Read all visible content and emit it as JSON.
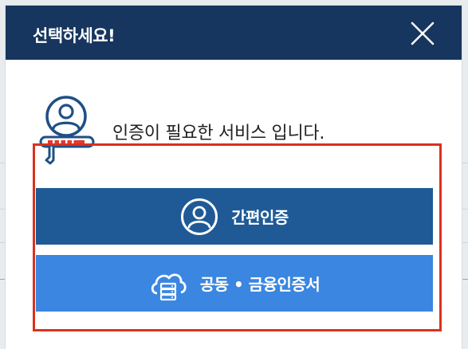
{
  "modal": {
    "title": "선택하세요!",
    "intro_text": "인증이 필요한 서비스 입니다.",
    "buttons": {
      "simple_auth": {
        "label": "간편인증",
        "icon": "user-circle-icon"
      },
      "certificate": {
        "label": "공동 • 금융인증서",
        "icon": "cloud-server-icon"
      }
    }
  },
  "colors": {
    "header_bg": "#16365f",
    "simple_button_bg": "#1f5a96",
    "certificate_button_bg": "#3a86e0",
    "highlight_border": "#d9321f"
  }
}
